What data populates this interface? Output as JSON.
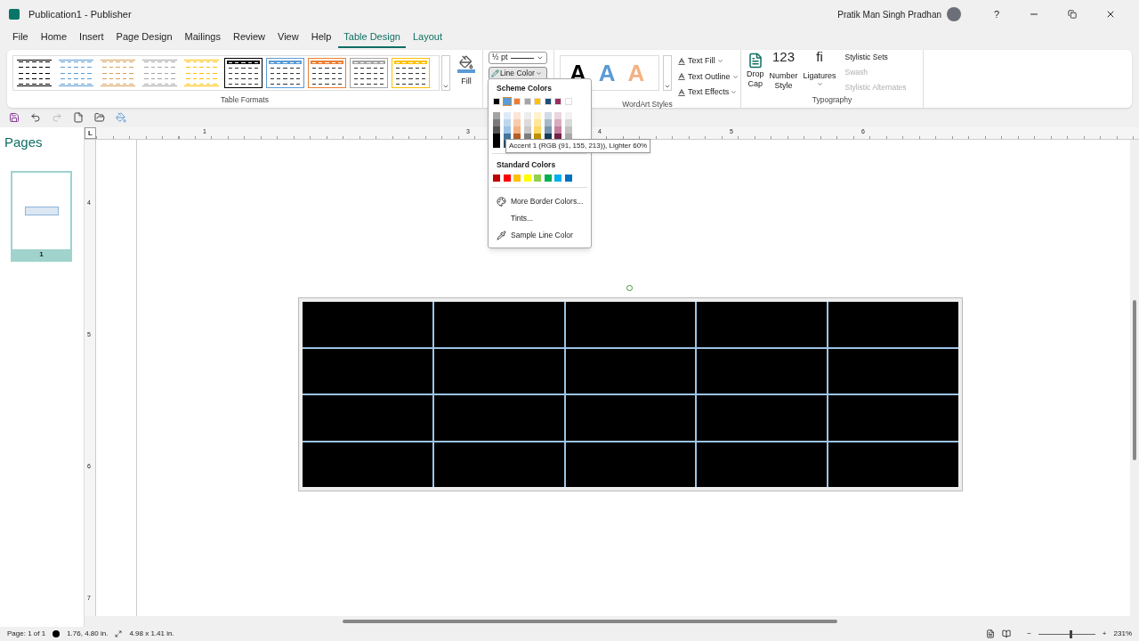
{
  "window": {
    "title": "Publication1 - Publisher",
    "user": "Pratik Man Singh Pradhan",
    "help": "?"
  },
  "tabs": [
    {
      "label": "File",
      "selected": false,
      "kind": "normal"
    },
    {
      "label": "Home",
      "selected": false,
      "kind": "normal"
    },
    {
      "label": "Insert",
      "selected": false,
      "kind": "normal"
    },
    {
      "label": "Page Design",
      "selected": false,
      "kind": "normal"
    },
    {
      "label": "Mailings",
      "selected": false,
      "kind": "normal"
    },
    {
      "label": "Review",
      "selected": false,
      "kind": "normal"
    },
    {
      "label": "View",
      "selected": false,
      "kind": "normal"
    },
    {
      "label": "Help",
      "selected": false,
      "kind": "normal"
    },
    {
      "label": "Table Design",
      "selected": true,
      "kind": "contextual"
    },
    {
      "label": "Layout",
      "selected": false,
      "kind": "contextual"
    }
  ],
  "table_formats": {
    "label": "Table Formats",
    "items": [
      {
        "kind": "lines",
        "color": "#000000"
      },
      {
        "kind": "lines",
        "color": "#5b9bd5"
      },
      {
        "kind": "lines",
        "color": "#d6a15a"
      },
      {
        "kind": "lines",
        "color": "#a5a5a5"
      },
      {
        "kind": "lines",
        "color": "#ffc000"
      },
      {
        "kind": "header",
        "color": "#000000"
      },
      {
        "kind": "header",
        "color": "#5b9bd5"
      },
      {
        "kind": "header",
        "color": "#ed7d31"
      },
      {
        "kind": "header",
        "color": "#a5a5a5"
      },
      {
        "kind": "header",
        "color": "#ffc000"
      }
    ]
  },
  "fill": {
    "label": "Fill"
  },
  "line_weight": {
    "value": "½ pt"
  },
  "line_color": {
    "label": "Line Color",
    "expanded": true
  },
  "wordart": {
    "label": "WordArt Styles",
    "samples": [
      {
        "text": "A",
        "color": "#000000"
      },
      {
        "text": "A",
        "color": "#5b9bd5"
      },
      {
        "text": "A",
        "color": "#f4b183"
      }
    ],
    "commands": [
      {
        "label": "Text Fill"
      },
      {
        "label": "Text Outline"
      },
      {
        "label": "Text Effects"
      }
    ]
  },
  "typography": {
    "label": "Typography",
    "buttons": [
      {
        "label": "Drop",
        "label2": "Cap",
        "kind": "dropcap"
      },
      {
        "glyph": "123",
        "label": "Number",
        "label2": "Style",
        "kind": "text"
      },
      {
        "glyph": "fi",
        "label": "Ligatures",
        "kind": "text"
      }
    ],
    "options": [
      {
        "label": "Stylistic Sets",
        "disabled": false
      },
      {
        "label": "Swash",
        "disabled": true
      },
      {
        "label": "Stylistic Alternates",
        "disabled": true
      }
    ]
  },
  "pages_panel": {
    "title": "Pages",
    "pages": [
      {
        "label": "1",
        "selected": true
      }
    ]
  },
  "ruler": {
    "corner": "L",
    "h_labels": [
      "1",
      "3",
      "4",
      "5",
      "6"
    ],
    "v_labels": [
      "4",
      "5",
      "6",
      "7"
    ]
  },
  "table": {
    "selected": true
  },
  "color_menu": {
    "scheme_title": "Scheme Colors",
    "scheme": [
      {
        "color": "#000000",
        "selected": false
      },
      {
        "color": "#5b9bd5",
        "selected": true
      },
      {
        "color": "#ed7d31",
        "selected": false
      },
      {
        "color": "#a5a5a5",
        "selected": false
      },
      {
        "color": "#ffc000",
        "selected": false
      },
      {
        "color": "#1f4e79",
        "selected": false
      },
      {
        "color": "#9b2d5f",
        "selected": false
      },
      {
        "color": "#ffffff",
        "selected": false
      }
    ],
    "standard_title": "Standard Colors",
    "standard": [
      {
        "color": "#c00000"
      },
      {
        "color": "#ff0000"
      },
      {
        "color": "#ffc000"
      },
      {
        "color": "#ffff00"
      },
      {
        "color": "#92d050"
      },
      {
        "color": "#00b050"
      },
      {
        "color": "#00b0f0"
      },
      {
        "color": "#0070c0"
      }
    ],
    "items": [
      {
        "label": "More Border Colors...",
        "kind": "palette"
      },
      {
        "label": "Tints...",
        "kind": "plain"
      },
      {
        "label": "Sample Line Color",
        "kind": "eyedropper"
      }
    ],
    "tooltip": "Accent 1 (RGB (91, 155, 213)), Lighter 60%"
  },
  "status_bar": {
    "page": "Page: 1 of 1",
    "position": "1.76, 4.80 in.",
    "size": "4.98 x 1.41 in.",
    "zoom": "231%",
    "zoom_out": "−",
    "zoom_in": "+",
    "level": 0.55
  }
}
